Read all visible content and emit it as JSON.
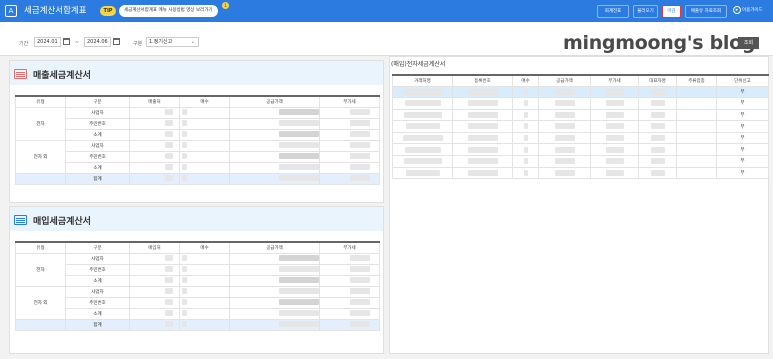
{
  "header": {
    "app_icon": "A",
    "title": "세금계산서합계표",
    "tip_badge": "TIP",
    "tip_text": "세금계산서합계표 메뉴 사용방법 영상 보러가기",
    "notification_count": "1",
    "buttons": [
      "회계전표",
      "불러오기",
      "마감",
      "매출유 자료조회"
    ],
    "active_button": "마감",
    "guide_label": "이용가이드"
  },
  "filters": {
    "period_label": "기간",
    "date_from": "2024.01",
    "tilde": "~",
    "date_to": "2024.06",
    "type_label": "구분",
    "type_value": "1.정기신고",
    "search_button": "조회"
  },
  "watermark": "mingmoong's blog",
  "sales_section": {
    "title": "매출세금계산서",
    "icon": "invoice-icon",
    "icon_color": "#e07070",
    "columns": [
      "유형",
      "구분",
      "매출처",
      "매수",
      "공급가액",
      "부가세"
    ],
    "rows": [
      {
        "group": "전자",
        "label": "사업자"
      },
      {
        "group": "",
        "label": "주민번호"
      },
      {
        "group": "",
        "label": "소계"
      },
      {
        "group": "전자 외",
        "label": "사업자"
      },
      {
        "group": "",
        "label": "주민번호"
      },
      {
        "group": "",
        "label": "소계"
      }
    ],
    "total_label": "합계"
  },
  "purchase_section": {
    "title": "매입세금계산서",
    "icon": "invoice-icon",
    "icon_color": "#2c7be0",
    "columns": [
      "유형",
      "구분",
      "매입처",
      "매수",
      "공급가액",
      "부가세"
    ],
    "rows": [
      {
        "group": "전자",
        "label": "사업자"
      },
      {
        "group": "",
        "label": "주민번호"
      },
      {
        "group": "",
        "label": "소계"
      },
      {
        "group": "전자 외",
        "label": "사업자"
      },
      {
        "group": "",
        "label": "주민번호"
      },
      {
        "group": "",
        "label": "소계"
      }
    ],
    "total_label": "합계"
  },
  "detail_table": {
    "title": "(매입)전자세금계산서",
    "columns": [
      "거래처명",
      "등록번호",
      "매수",
      "공급가액",
      "부가세",
      "대표자명",
      "주류업종",
      "단위신고"
    ],
    "unit_values": [
      "부",
      "부",
      "부",
      "부",
      "부",
      "부",
      "부",
      "부"
    ]
  }
}
